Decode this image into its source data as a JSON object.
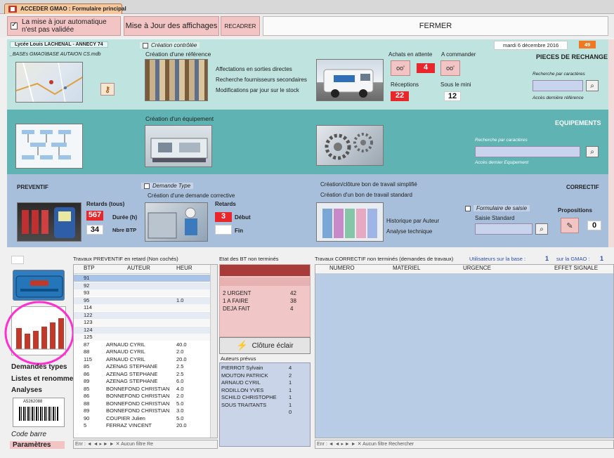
{
  "window": {
    "tab_title": "ACCEDER GMAO : Formulaire principal"
  },
  "toolbar": {
    "auto_update_label": "La mise à jour automatique n'est pas validée",
    "update_button": "Mise à Jour des affichages",
    "reframe_button": "RECADRER",
    "close_button": "FERMER"
  },
  "header": {
    "school": "Lycée Louis LACHENAL - ANNECY 74",
    "db_path": "_BASEs GMAO\\BASE AUTAION CS.mdb",
    "date": "mardi 6 décembre 2016",
    "week": "49"
  },
  "pieces": {
    "controlled_label": "Création contrôlée",
    "create_ref": "Création d'une référence",
    "links": [
      "Affectations en sorties directes",
      "Recherche fournisseurs secondaires",
      "Modifications par jour sur le stock"
    ],
    "achats_label": "Achats en attente",
    "achats_value": "4",
    "acommander_label": "A commander",
    "receptions_label": "Réceptions",
    "receptions_value": "22",
    "souslemini_label": "Sous le mini",
    "souslemini_value": "12",
    "title": "PIECES DE RECHANGE",
    "search_label": "Recherche par caractères",
    "last_ref": "Accès dernière référence"
  },
  "equipements": {
    "create_label": "Création d'un équipement",
    "title": "EQUIPEMENTS",
    "search_label": "Recherche par caractères",
    "last_equip": "Accès dernier Equipement"
  },
  "preventif": {
    "title": "PREVENTIF",
    "type_label": "Demande Type",
    "create_corrective": "Création d'une demande corrective",
    "retards_tous": "Retards (tous)",
    "retards_value": "567",
    "duree_label": "Durée (h)",
    "nbre_value": "34",
    "nbre_label": "Nbre BTP",
    "retards2": "Retards",
    "retards2_value": "3",
    "debut": "Début",
    "fin": "Fin"
  },
  "correctif": {
    "title": "CORRECTIF",
    "bt_simplifie": "Création/clôture bon de travail simplifié",
    "bt_standard": "Création d'un bon de travail standard",
    "historique": "Historique par Auteur",
    "analyse": "Analyse technique",
    "formulaire_label": "Formulaire de saisie",
    "saisie_standard": "Saisie Standard",
    "propositions": "Propositions",
    "propositions_value": "0"
  },
  "lists": {
    "prev_title": "Travaux PREVENTIF en retard  (Non cochés)",
    "etat_title": "Etat des BT non terminés",
    "corr_title": "Travaux CORRECTIF non terminés (demandes de travaux)",
    "users_label": "Utilisateurs sur la base :",
    "users_value": "1",
    "gmao_label": "sur la GMAO :",
    "gmao_value": "1"
  },
  "prev_grid": {
    "headers": [
      "BTP",
      "AUTEUR",
      "HEUR"
    ],
    "rows": [
      [
        "91",
        "",
        ""
      ],
      [
        "92",
        "",
        ""
      ],
      [
        "93",
        "",
        ""
      ],
      [
        "95",
        "",
        "1.0"
      ],
      [
        "114",
        "",
        ""
      ],
      [
        "122",
        "",
        ""
      ],
      [
        "123",
        "",
        ""
      ],
      [
        "124",
        "",
        ""
      ],
      [
        "125",
        "",
        ""
      ],
      [
        "87",
        "ARNAUD CYRIL",
        "40.0"
      ],
      [
        "88",
        "ARNAUD CYRIL",
        "2.0"
      ],
      [
        "115",
        "ARNAUD CYRIL",
        "20.0"
      ],
      [
        "85",
        "AZENAG STEPHANE",
        "2.5"
      ],
      [
        "86",
        "AZENAG STEPHANE",
        "2.5"
      ],
      [
        "89",
        "AZENAG STEPHANE",
        "6.0"
      ],
      [
        "85",
        "BONNEFOND CHRISTIAN",
        "4.0"
      ],
      [
        "86",
        "BONNEFOND CHRISTIAN",
        "2.0"
      ],
      [
        "88",
        "BONNEFOND CHRISTIAN",
        "5.0"
      ],
      [
        "89",
        "BONNEFOND CHRISTIAN",
        "3.0"
      ],
      [
        "90",
        "COUPIER Julien",
        "5.0"
      ],
      [
        "5",
        "FERRAZ VINCENT",
        "20.0"
      ]
    ],
    "nav": "Enr : ◄ ◄   ▸  ► ►  ✕ Aucun filtre  Re"
  },
  "etat": {
    "rows": [
      [
        "2 URGENT",
        "42"
      ],
      [
        "1 A FAIRE",
        "38"
      ],
      [
        "DEJA FAIT",
        "4"
      ]
    ],
    "cloture_button": "Clôture éclair",
    "auteurs_title": "Auteurs prévus",
    "auteurs": [
      [
        "PIERROT Sylvain",
        "4"
      ],
      [
        "MOUTON PATRICK",
        "2"
      ],
      [
        "ARNAUD CYRIL",
        "1"
      ],
      [
        "RODILLON YVES",
        "1"
      ],
      [
        "SCHILD CHRISTOPHE",
        "1"
      ],
      [
        "SOUS TRAITANTS",
        "1"
      ],
      [
        "",
        "0"
      ]
    ]
  },
  "corr_grid": {
    "headers": [
      "NUMERO",
      "MATERIEL",
      "URGENCE",
      "EFFET SIGNALE"
    ],
    "nav": "Enr : ◄ ◄   ▸ ► ►  ✕ Aucun filtre   Rechercher"
  },
  "sidebar": {
    "items": [
      "Demandes types",
      "Listes et renommer",
      "Analyses",
      "Code barre",
      "Paramètres"
    ],
    "barcode_text": "A5262088"
  },
  "colors": {
    "accent_red": "#e8262b",
    "orange": "#f07820",
    "pink_button": "#f2c4c4"
  }
}
